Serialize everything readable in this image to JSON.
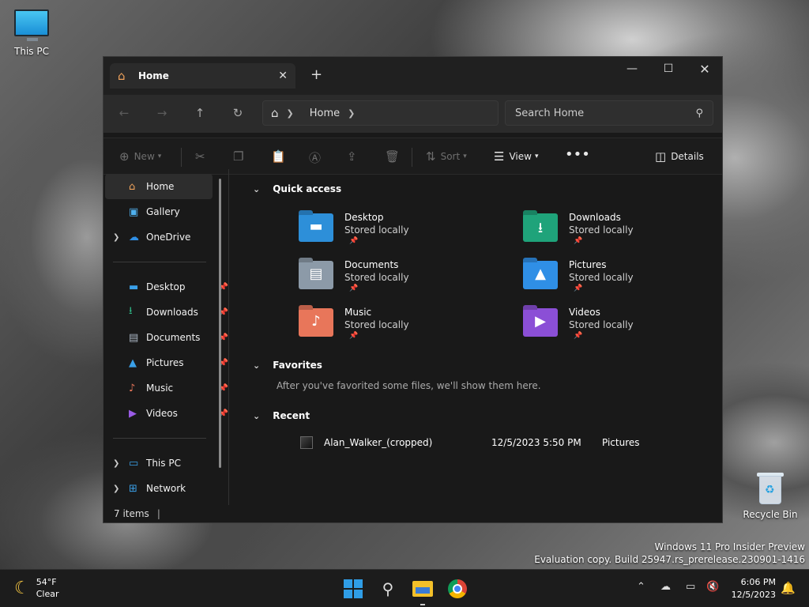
{
  "desktop": {
    "this_pc_label": "This PC",
    "recycle_bin_label": "Recycle Bin",
    "watermark_line1": "Windows 11 Pro Insider Preview",
    "watermark_line2": "Evaluation copy. Build 25947.rs_prerelease.230901-1416"
  },
  "window": {
    "tab_title": "Home",
    "address": {
      "segment": "Home"
    },
    "search_placeholder": "Search Home",
    "toolbar": {
      "new_label": "New",
      "sort_label": "Sort",
      "view_label": "View",
      "details_label": "Details"
    },
    "sidebar": {
      "top": [
        {
          "label": "Home"
        },
        {
          "label": "Gallery"
        },
        {
          "label": "OneDrive"
        }
      ],
      "pinned": [
        {
          "label": "Desktop"
        },
        {
          "label": "Downloads"
        },
        {
          "label": "Documents"
        },
        {
          "label": "Pictures"
        },
        {
          "label": "Music"
        },
        {
          "label": "Videos"
        }
      ],
      "bottom": [
        {
          "label": "This PC"
        },
        {
          "label": "Network"
        }
      ]
    },
    "quick_access": {
      "heading": "Quick access",
      "items": [
        {
          "name": "Desktop",
          "status": "Stored locally",
          "color": "#2d8fd9"
        },
        {
          "name": "Downloads",
          "status": "Stored locally",
          "color": "#1fa37a"
        },
        {
          "name": "Documents",
          "status": "Stored locally",
          "color": "#8c9aa8"
        },
        {
          "name": "Pictures",
          "status": "Stored locally",
          "color": "#2f8fe6"
        },
        {
          "name": "Music",
          "status": "Stored locally",
          "color": "#e8765a"
        },
        {
          "name": "Videos",
          "status": "Stored locally",
          "color": "#8b4fd6"
        }
      ]
    },
    "favorites": {
      "heading": "Favorites",
      "empty_message": "After you've favorited some files, we'll show them here."
    },
    "recent": {
      "heading": "Recent",
      "rows": [
        {
          "name": "Alan_Walker_(cropped)",
          "date": "12/5/2023 5:50 PM",
          "location": "Pictures"
        }
      ]
    },
    "status_bar": {
      "items_count": "7 items"
    }
  },
  "taskbar": {
    "weather_temp": "54°F",
    "weather_desc": "Clear",
    "clock_time": "6:06 PM",
    "clock_date": "12/5/2023"
  }
}
